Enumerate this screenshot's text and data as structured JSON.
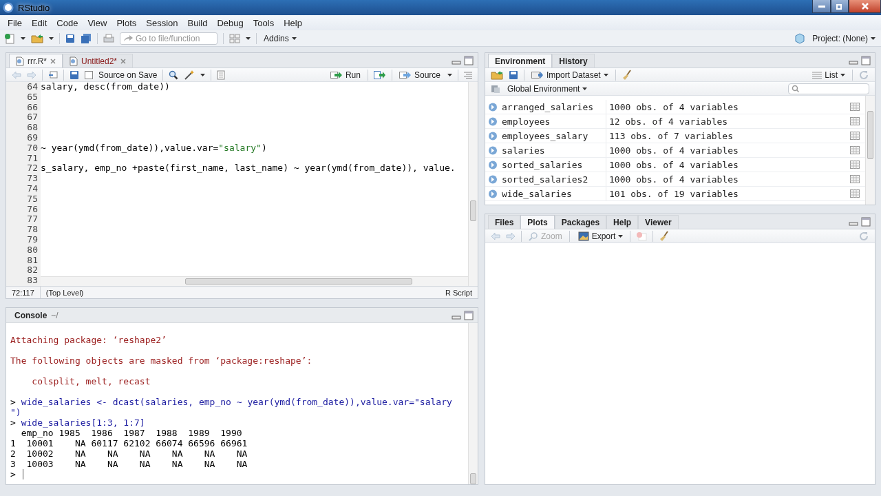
{
  "window": {
    "title": "RStudio"
  },
  "menu": [
    "File",
    "Edit",
    "Code",
    "View",
    "Plots",
    "Session",
    "Build",
    "Debug",
    "Tools",
    "Help"
  ],
  "toolbar": {
    "goto_placeholder": "Go to file/function",
    "addins": "Addins",
    "project": "Project: (None)"
  },
  "editor": {
    "tabs": [
      {
        "label": "rrr.R*",
        "selected": true,
        "modified": false
      },
      {
        "label": "Untitled2*",
        "selected": false,
        "modified": true
      }
    ],
    "source_on_save": {
      "label": "Source on Save",
      "checked": false
    },
    "run": "Run",
    "source": "Source",
    "lines": [
      {
        "number": "64",
        "parts": [
          {
            "kind": "code",
            "text": "salary, desc(from_date))"
          }
        ]
      },
      {
        "number": "65"
      },
      {
        "number": "66"
      },
      {
        "number": "67"
      },
      {
        "number": "68"
      },
      {
        "number": "69"
      },
      {
        "number": "70",
        "parts": [
          {
            "kind": "code",
            "text": "~ year(ymd(from_date)),value.var="
          },
          {
            "kind": "string",
            "text": "\"salary\""
          },
          {
            "kind": "code",
            "text": ")"
          }
        ]
      },
      {
        "number": "71"
      },
      {
        "number": "72",
        "parts": [
          {
            "kind": "code",
            "text": "s_salary, emp_no +paste(first_name, last_name) ~ year(ymd(from_date)), value."
          }
        ]
      },
      {
        "number": "73"
      },
      {
        "number": "74"
      },
      {
        "number": "75"
      },
      {
        "number": "76"
      },
      {
        "number": "77"
      },
      {
        "number": "78"
      },
      {
        "number": "79"
      },
      {
        "number": "80"
      },
      {
        "number": "81"
      },
      {
        "number": "82"
      },
      {
        "number": "83"
      }
    ],
    "status": {
      "position": "72:117",
      "scope": "(Top Level)",
      "type": "R Script"
    }
  },
  "console": {
    "title": "Console",
    "path": "~/",
    "lines": [
      {
        "kind": "blank"
      },
      {
        "kind": "message",
        "text": "Attaching package: ‘reshape2’"
      },
      {
        "kind": "blank"
      },
      {
        "kind": "message",
        "text": "The following objects are masked from ‘package:reshape’:"
      },
      {
        "kind": "blank"
      },
      {
        "kind": "message",
        "text": "    colsplit, melt, recast"
      },
      {
        "kind": "blank"
      },
      {
        "kind": "input",
        "prompt": ">",
        "text": "wide_salaries <- dcast(salaries, emp_no ~ year(ymd(from_date)),value.var=\"salary"
      },
      {
        "kind": "continuation",
        "text": "\")"
      },
      {
        "kind": "input",
        "prompt": ">",
        "text": "wide_salaries[1:3, 1:7]"
      },
      {
        "kind": "output",
        "text": "  emp_no 1985  1986  1987  1988  1989  1990"
      },
      {
        "kind": "output",
        "text": "1  10001    NA 60117 62102 66074 66596 66961"
      },
      {
        "kind": "output",
        "text": "2  10002    NA    NA    NA    NA    NA    NA"
      },
      {
        "kind": "output",
        "text": "3  10003    NA    NA    NA    NA    NA    NA"
      },
      {
        "kind": "input",
        "prompt": ">"
      }
    ]
  },
  "environment": {
    "tabs": [
      {
        "label": "Environment",
        "selected": true
      },
      {
        "label": "History",
        "selected": false
      }
    ],
    "import": "Import Dataset",
    "view": "List",
    "scope": "Global Environment",
    "rows": [
      {
        "name": "arranged_salaries",
        "value": "1000 obs. of 4 variables"
      },
      {
        "name": "employees",
        "value": "12 obs. of 4 variables"
      },
      {
        "name": "employees_salary",
        "value": "113 obs. of 7 variables"
      },
      {
        "name": "salaries",
        "value": "1000 obs. of 4 variables"
      },
      {
        "name": "sorted_salaries",
        "value": "1000 obs. of 4 variables"
      },
      {
        "name": "sorted_salaries2",
        "value": "1000 obs. of 4 variables"
      },
      {
        "name": "wide_salaries",
        "value": "101 obs. of 19 variables"
      }
    ]
  },
  "files": {
    "tabs": [
      {
        "label": "Files",
        "selected": false
      },
      {
        "label": "Plots",
        "selected": true
      },
      {
        "label": "Packages",
        "selected": false
      },
      {
        "label": "Help",
        "selected": false
      },
      {
        "label": "Viewer",
        "selected": false
      }
    ],
    "zoom": "Zoom",
    "export": "Export"
  }
}
